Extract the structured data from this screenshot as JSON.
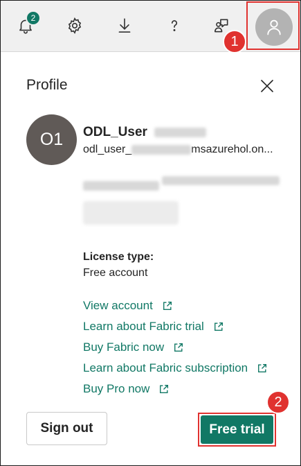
{
  "topbar": {
    "notifications": {
      "icon": "bell-icon",
      "badge_count": "2"
    },
    "settings": {
      "icon": "gear-icon"
    },
    "download": {
      "icon": "download-icon"
    },
    "help": {
      "icon": "help-icon",
      "glyph": "?"
    },
    "share": {
      "icon": "feedback-icon"
    },
    "account": {
      "icon": "person-icon"
    }
  },
  "callouts": {
    "step1": "1",
    "step2": "2"
  },
  "profile": {
    "title": "Profile",
    "avatar_initials": "O1",
    "user_name": "ODL_User",
    "email_prefix": "odl_user_",
    "email_suffix": "msazurehol.on...",
    "license_label": "License type:",
    "license_value": "Free account",
    "links": [
      "View account",
      "Learn about Fabric trial",
      "Buy Fabric now",
      "Learn about Fabric subscription",
      "Buy Pro now"
    ],
    "sign_out_label": "Sign out",
    "free_trial_label": "Free trial"
  },
  "colors": {
    "accent": "#117865",
    "highlight": "#e0322f",
    "avatar_bg": "#605a57"
  }
}
